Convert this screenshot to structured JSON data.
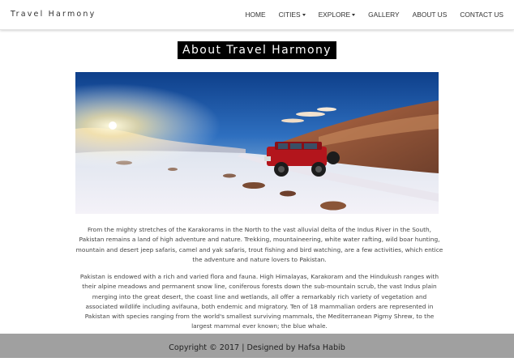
{
  "nav": {
    "brand": "Travel Harmony",
    "items": [
      {
        "label": "HOME"
      },
      {
        "label": "CITIES"
      },
      {
        "label": "EXPLORE"
      },
      {
        "label": "GALLERY"
      },
      {
        "label": "ABOUT US"
      },
      {
        "label": "CONTACT US"
      }
    ]
  },
  "main": {
    "title": "About Travel Harmony",
    "paragraphs": [
      "From the mighty stretches of the Karakorams in the North to the vast alluvial delta of the Indus River in the South, Pakistan remains a land of high adventure and nature. Trekking, mountaineering, white water rafting, wild boar hunting, mountain and desert jeep safaris, camel and yak safaris, trout fishing and bird watching, are a few activities, which entice the adventure and nature lovers to Pakistan.",
      "Pakistan is endowed with a rich and varied flora and fauna. High Himalayas, Karakoram and the Hindukush ranges with their alpine meadows and permanent snow line, coniferous forests down the sub-mountain scrub, the vast Indus plain merging into the great desert, the coast line and wetlands, all offer a remarkably rich variety of vegetation and associated wildlife including avifauna, both endemic and migratory. Ten of 18 mammalian orders are represented in Pakistan with species ranging from the world's smallest surviving mammals, the Mediterranean Pigmy Shrew, to the largest mammal ever known; the blue whale."
    ]
  },
  "footer": {
    "text": "Copyright © 2017 | Designed by Hafsa Habib"
  },
  "colors": {
    "footer_bg": "#a0a0a0",
    "title_bg": "#000000",
    "jeep": "#b3151c"
  },
  "icons": {
    "dropdown": "caret-down-icon"
  }
}
